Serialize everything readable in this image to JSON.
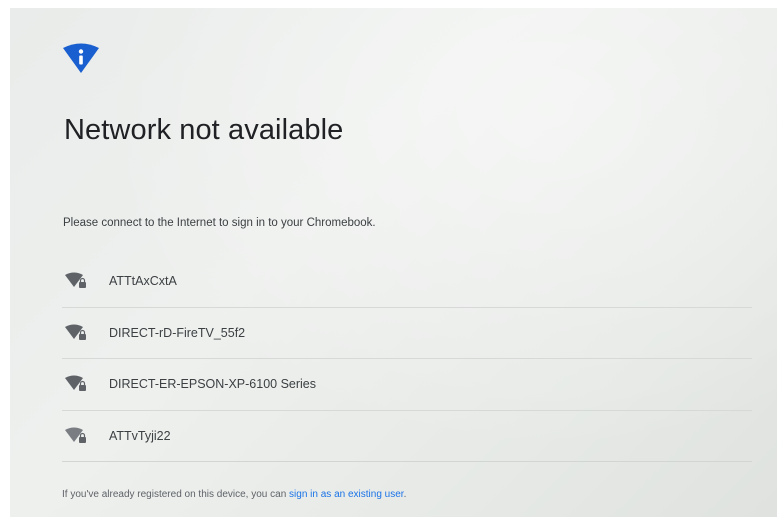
{
  "header": {
    "icon": "info-icon",
    "title": "Network not available"
  },
  "message": "Please connect to the Internet to sign in to your Chromebook.",
  "networks": [
    {
      "name": "ATTtAxCxtA",
      "icon": "wifi-locked-icon"
    },
    {
      "name": "DIRECT-rD-FireTV_55f2",
      "icon": "wifi-locked-icon"
    },
    {
      "name": "DIRECT-ER-EPSON-XP-6100 Series",
      "icon": "wifi-locked-icon"
    },
    {
      "name": "ATTvTyji22",
      "icon": "wifi-locked-icon"
    }
  ],
  "footer": {
    "text": "If you've already registered on this device, you can ",
    "link_label": "sign in as an existing user",
    "end": "."
  },
  "colors": {
    "accent_blue": "#1a5fd0",
    "link_blue": "#1a73e8",
    "title_text": "#202124"
  }
}
